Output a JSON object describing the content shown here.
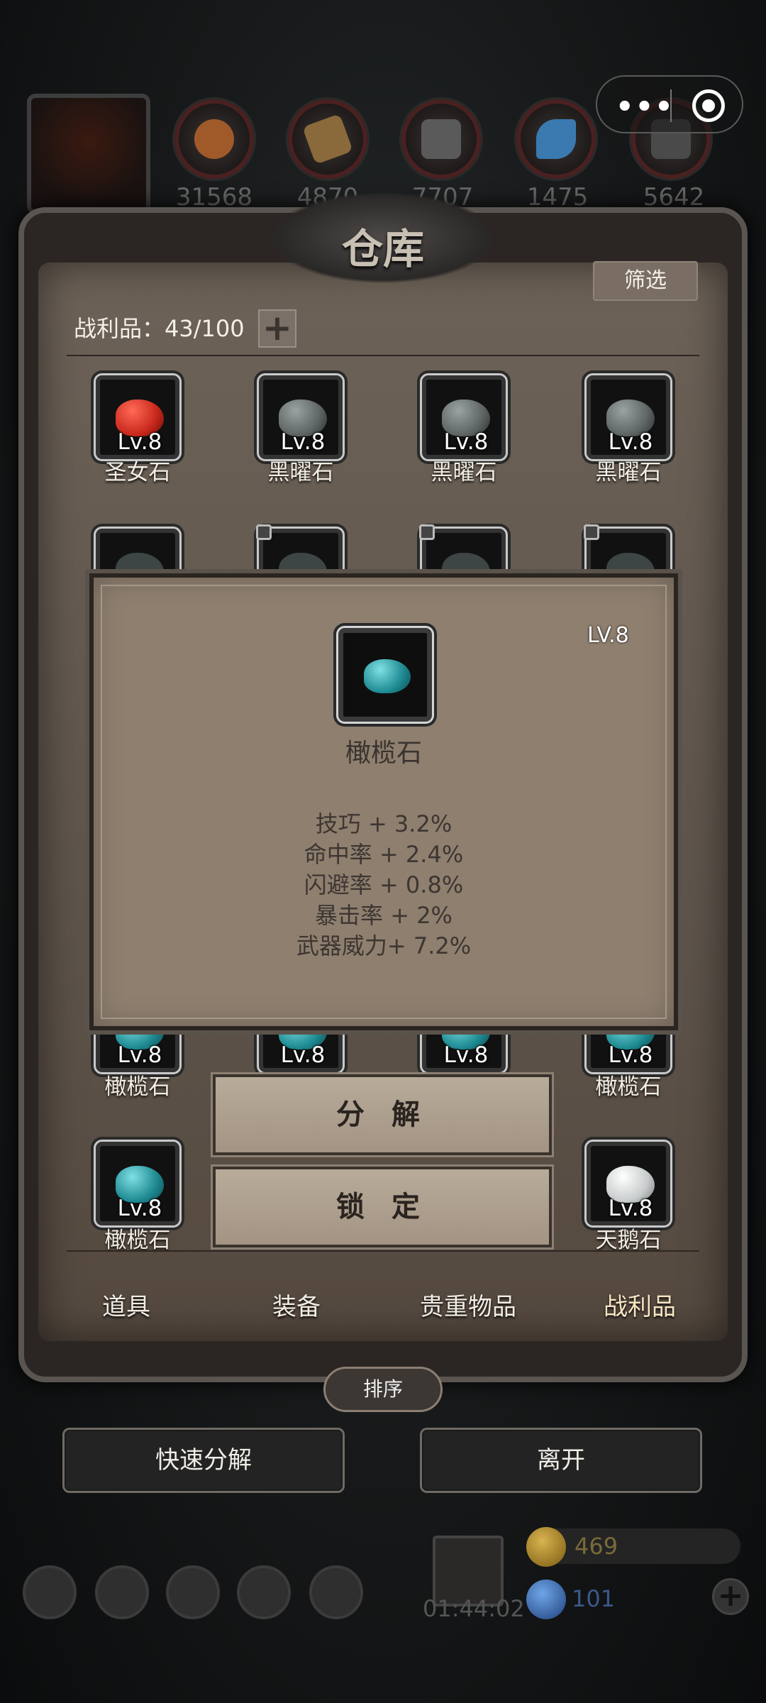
{
  "resources": [
    {
      "name": "wood-log-icon",
      "count": "31568",
      "color": "#a05a2a"
    },
    {
      "name": "plank-icon",
      "count": "4870",
      "color": "#8a6a3a"
    },
    {
      "name": "iron-ingot-icon",
      "count": "7707",
      "color": "#5a5a5a"
    },
    {
      "name": "crystal-icon",
      "count": "1475",
      "color": "#3a7ab0"
    },
    {
      "name": "metal-plate-icon",
      "count": "5642",
      "color": "#4a4a4a"
    }
  ],
  "panel": {
    "title": "仓库",
    "filter_label": "筛选",
    "capacity_label": "战利品：43/100",
    "add_label": "+"
  },
  "items": {
    "row1": [
      {
        "name": "圣女石",
        "level": "Lv.8",
        "color": "#c8281c"
      },
      {
        "name": "黑曜石",
        "level": "Lv.8",
        "color": "#5e6564"
      },
      {
        "name": "黑曜石",
        "level": "Lv.8",
        "color": "#5e6564"
      },
      {
        "name": "黑曜石",
        "level": "Lv.8",
        "color": "#5e6564"
      }
    ],
    "row3": [
      {
        "name": "橄榄石",
        "level": "Lv.8"
      },
      {
        "name": "",
        "level": "Lv.8"
      },
      {
        "name": "",
        "level": "Lv.8"
      },
      {
        "name": "橄榄石",
        "level": "Lv.8"
      }
    ],
    "row4": [
      {
        "name": "橄榄石",
        "level": "Lv.8",
        "color": "#1f8a92"
      },
      {
        "name": "天鹅石",
        "level": "Lv.8",
        "color": "#c8cccc"
      }
    ]
  },
  "tooltip": {
    "level": "LV.8",
    "name": "橄榄石",
    "stats": [
      "技巧 + 3.2%",
      "命中率 + 2.4%",
      "闪避率 + 0.8%",
      "暴击率 + 2%",
      "武器威力+ 7.2%"
    ]
  },
  "actions": {
    "decompose": "分 解",
    "lock": "锁 定"
  },
  "tabs": [
    "道具",
    "装备",
    "贵重物品",
    "战利品"
  ],
  "active_tab": "战利品",
  "sort_label": "排序",
  "quick_decompose_label": "快速分解",
  "leave_label": "离开",
  "bottom": {
    "timer": "01:44:02",
    "gold": "469",
    "gems": "101",
    "gold_color": "#7a6a3a",
    "gems_color": "#3a5a8a"
  },
  "colors": {
    "accent": "#f7e5c3",
    "panel": "#6d6257"
  }
}
